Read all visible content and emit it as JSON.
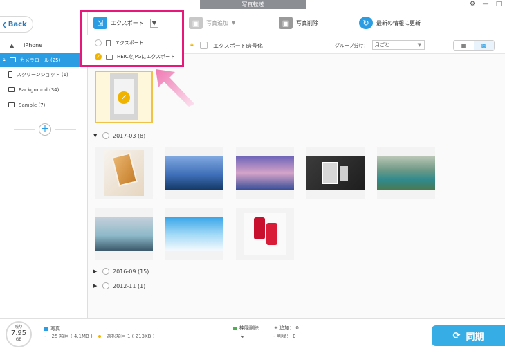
{
  "window": {
    "title": "写真転送",
    "controls": [
      "⚙",
      "—",
      "□"
    ]
  },
  "sidebar": {
    "back_label": "Back",
    "device_icon": "triangle-icon",
    "device_name": "iPhone",
    "albums": [
      {
        "label": "カメラロール (25)",
        "active": true
      },
      {
        "label": "スクリーンショット (1)",
        "active": false
      },
      {
        "label": "Background (34)",
        "active": false
      },
      {
        "label": "Sample (7)",
        "active": false
      }
    ],
    "add_label": "+"
  },
  "toolbar": {
    "export_label": "エクスポート",
    "add_photo_label": "写真追加",
    "delete_label": "写真削除",
    "refresh_label": "最新の情報に更新"
  },
  "export_menu": {
    "items": [
      {
        "label": "エクスポート",
        "selected": false
      },
      {
        "label": "HEICをJPGにエクスポート",
        "selected": true
      }
    ]
  },
  "filterbar": {
    "encrypt_label": "エクスポート暗号化",
    "group_label": "グループ分け：",
    "group_value": "月ごと"
  },
  "groups": [
    {
      "label": "2017-03 (8)",
      "expanded": true
    },
    {
      "label": "2016-09 (15)",
      "expanded": false
    },
    {
      "label": "2012-11 (1)",
      "expanded": false
    }
  ],
  "footer": {
    "storage_label": "残り",
    "storage_value": "7.95",
    "storage_unit": "GB",
    "category_label": "写真",
    "items_stat": "25 項目 ( 4.1MB )",
    "selected_stat": "選択項目 1 ( 213KB )",
    "legend_delete": "楝隠削除",
    "legend_add": "追加： 0",
    "legend_remove": "削除： 0",
    "sync_label": "同期"
  },
  "colors": {
    "accent": "#2b9ee3",
    "highlight": "#e7177c",
    "selected": "#f0b400",
    "sync": "#36aee5"
  }
}
